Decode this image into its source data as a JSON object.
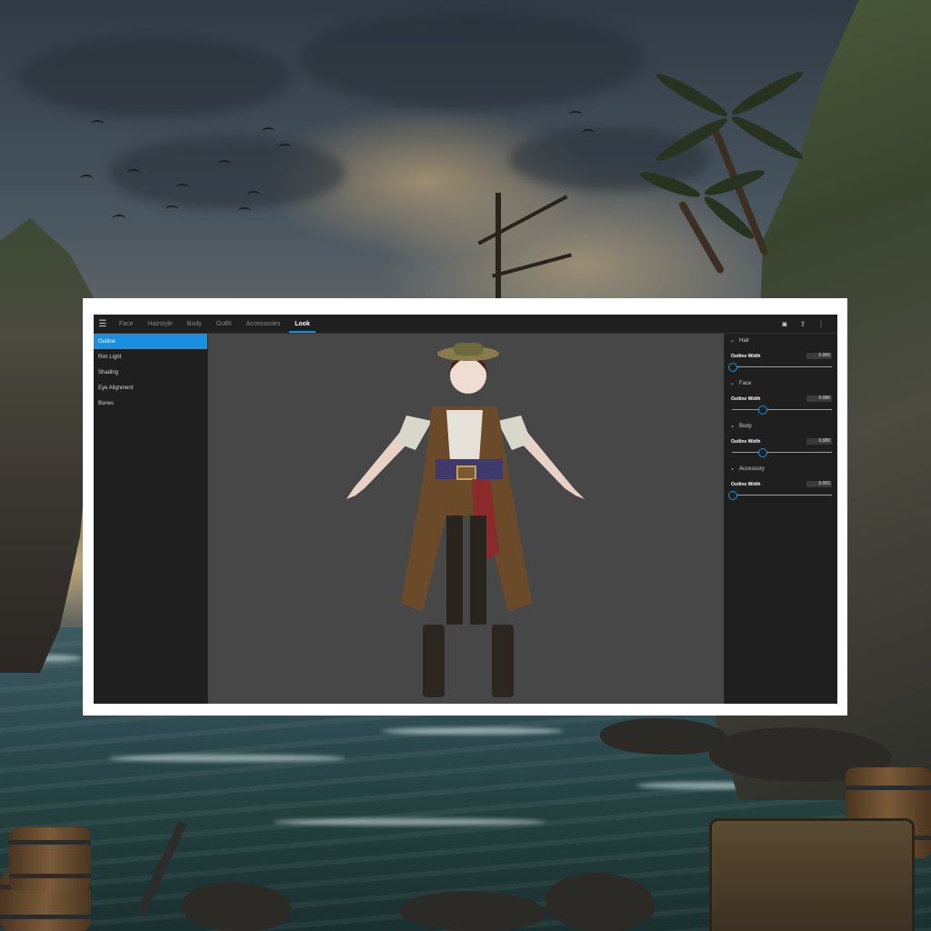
{
  "app": {
    "tabs": [
      {
        "label": "Face"
      },
      {
        "label": "Hairstyle"
      },
      {
        "label": "Body"
      },
      {
        "label": "Outfit"
      },
      {
        "label": "Accessories"
      },
      {
        "label": "Look"
      }
    ],
    "active_tab": "Look",
    "top_actions": [
      {
        "icon": "camera-icon",
        "glyph": "◙"
      },
      {
        "icon": "share-icon",
        "glyph": "⇪"
      },
      {
        "icon": "more-icon",
        "glyph": "⋮"
      }
    ],
    "left_nav": [
      {
        "label": "Outline",
        "active": true
      },
      {
        "label": "Rim Light"
      },
      {
        "label": "Shading"
      },
      {
        "label": "Eye Alignment"
      },
      {
        "label": "Bones"
      }
    ],
    "right_panel": {
      "sections": [
        {
          "title": "Hair",
          "label": "Outline Width",
          "value": "0.000",
          "slider_fraction": 0.0
        },
        {
          "title": "Face",
          "label": "Outline Width",
          "value": "0.080",
          "slider_fraction": 0.3
        },
        {
          "title": "Body",
          "label": "Outline Width",
          "value": "0.080",
          "slider_fraction": 0.3
        },
        {
          "title": "Accessory",
          "label": "Outline Width",
          "value": "0.000",
          "slider_fraction": 0.0
        }
      ]
    },
    "colors": {
      "accent": "#1a8fe0",
      "panel": "#1f1f1f",
      "viewport": "#474747"
    }
  }
}
